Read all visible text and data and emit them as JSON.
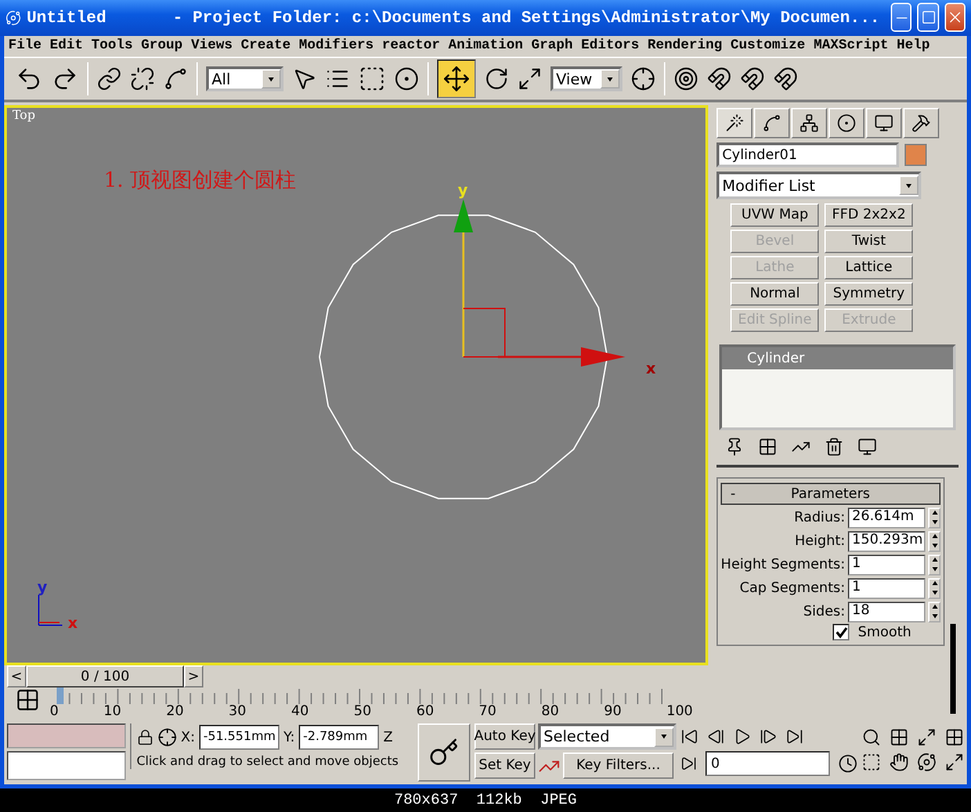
{
  "window": {
    "title": "Untitled",
    "project": "- Project Folder: c:\\Documents and Settings\\Administrator\\My Documen..."
  },
  "menu": [
    "File",
    "Edit",
    "Tools",
    "Group",
    "Views",
    "Create",
    "Modifiers",
    "reactor",
    "Animation",
    "Graph Editors",
    "Rendering",
    "Customize",
    "MAXScript",
    "Help"
  ],
  "toolbar": {
    "selection_filter": "All",
    "reference_coord": "View"
  },
  "viewport": {
    "label": "Top",
    "note": "1. 顶视图创建个圆柱",
    "axis_x": "x",
    "axis_y": "y",
    "world_x": "x",
    "world_y": "y"
  },
  "command_panel": {
    "object_name": "Cylinder01",
    "modifier_list": "Modifier List",
    "modifier_buttons": [
      {
        "label": "UVW Map",
        "disabled": false
      },
      {
        "label": "FFD 2x2x2",
        "disabled": false
      },
      {
        "label": "Bevel",
        "disabled": true
      },
      {
        "label": "Twist",
        "disabled": false
      },
      {
        "label": "Lathe",
        "disabled": true
      },
      {
        "label": "Lattice",
        "disabled": false
      },
      {
        "label": "Normal",
        "disabled": false
      },
      {
        "label": "Symmetry",
        "disabled": false
      },
      {
        "label": "Edit Spline",
        "disabled": true
      },
      {
        "label": "Extrude",
        "disabled": true
      }
    ],
    "stack": [
      {
        "label": "Cylinder",
        "selected": true
      }
    ],
    "rollout": {
      "collapse": "-",
      "title": "Parameters",
      "params": [
        {
          "label": "Radius:",
          "value": "26.614m"
        },
        {
          "label": "Height:",
          "value": "150.293m"
        },
        {
          "label": "Height Segments:",
          "value": "1"
        },
        {
          "label": "Cap Segments:",
          "value": "1"
        },
        {
          "label": "Sides:",
          "value": "18"
        }
      ],
      "smooth": {
        "label": "Smooth",
        "checked": true
      }
    }
  },
  "timeline": {
    "prev": "<",
    "frame": "0 / 100",
    "next": ">",
    "ticks": [
      "0",
      "10",
      "20",
      "30",
      "40",
      "50",
      "60",
      "70",
      "80",
      "90",
      "100"
    ]
  },
  "status": {
    "x_label": "X:",
    "x": "-51.551mm",
    "y_label": "Y:",
    "y": "-2.789mm",
    "z_label": "Z",
    "prompt": "Click and drag to select and move objects"
  },
  "animation": {
    "auto_key": "Auto Key",
    "set_key": "Set Key",
    "key_mode": "Selected",
    "key_filters": "Key Filters...",
    "current_frame": "0"
  },
  "caption": "780x637  112kb  JPEG"
}
